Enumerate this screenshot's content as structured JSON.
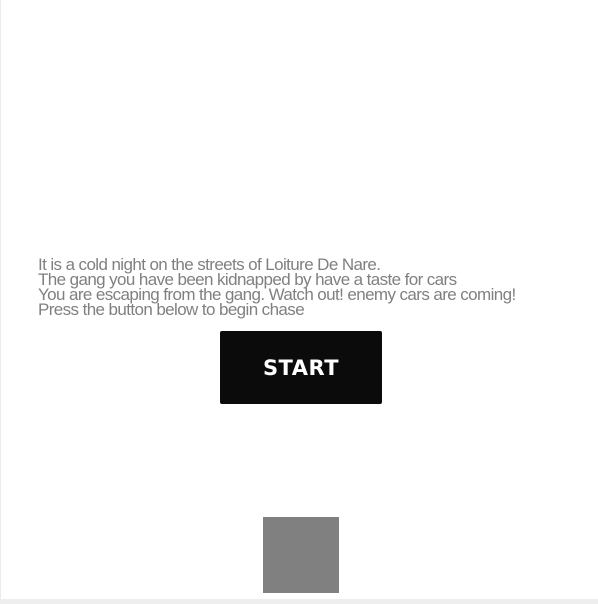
{
  "story": {
    "lines": [
      "It is a cold night on the streets of Loiture De Nare.",
      "The gang you have been kidnapped by have a taste for cars",
      "You are escaping from the gang. Watch out! enemy cars are coming!",
      "Press the button below to begin chase"
    ]
  },
  "start_button": {
    "label": "START"
  },
  "colors": {
    "text": "#808080",
    "button_bg": "#0b0b0b",
    "button_text": "#ffffff",
    "player_car": "#808080",
    "background": "#ffffff"
  }
}
